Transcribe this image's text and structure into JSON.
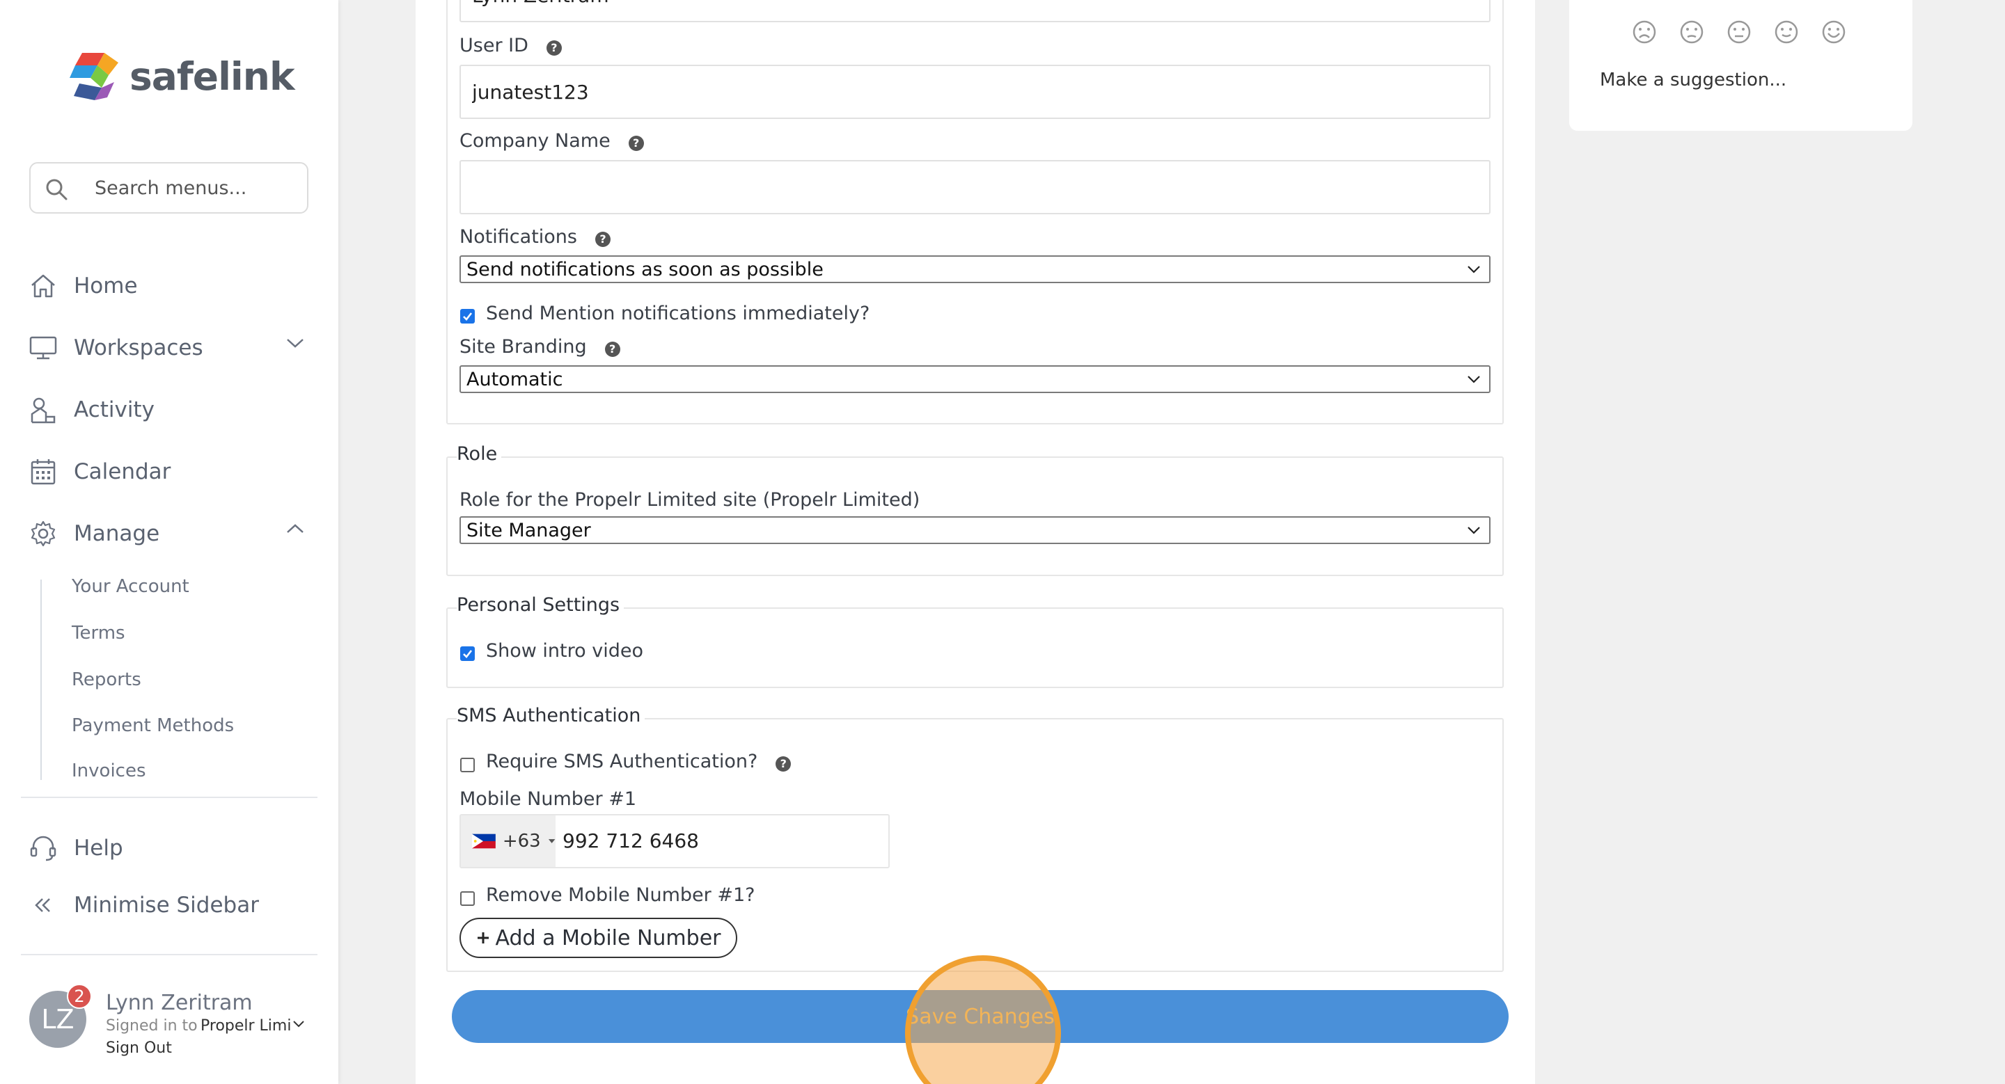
{
  "brand": {
    "name": "safelink"
  },
  "search": {
    "placeholder": "Search menus..."
  },
  "nav": {
    "home": "Home",
    "workspaces": "Workspaces",
    "activity": "Activity",
    "calendar": "Calendar",
    "manage": "Manage",
    "manage_items": [
      "Your Account",
      "Terms",
      "Reports",
      "Payment Methods",
      "Invoices"
    ],
    "help": "Help",
    "minimise": "Minimise Sidebar"
  },
  "user": {
    "initials": "LZ",
    "notifications": "2",
    "name": "Lynn Zeritram",
    "signed_in_label": "Signed in to",
    "organisation": "Propelr Limited",
    "sign_out": "Sign Out"
  },
  "form": {
    "name_value": "Lynn Zeritram",
    "user_id_label": "User ID",
    "user_id_value": "junatest123",
    "company_label": "Company Name",
    "company_value": "",
    "notifications_label": "Notifications",
    "notifications_value": "Send notifications as soon as possible",
    "mention_label": "Send Mention notifications immediately?",
    "site_branding_label": "Site Branding",
    "site_branding_value": "Automatic",
    "role_legend": "Role",
    "role_label": "Role for the Propelr Limited site (Propelr Limited)",
    "role_value": "Site Manager",
    "personal_legend": "Personal Settings",
    "intro_label": "Show intro video",
    "sms_legend": "SMS Authentication",
    "sms_label": "Require SMS Authentication?",
    "mobile_label": "Mobile Number #1",
    "country_code": "+63",
    "mobile_value": "992 712 6468",
    "remove_label": "Remove Mobile Number #1?",
    "add_mobile": "Add a Mobile Number",
    "save": "Save Changes"
  },
  "feedback": {
    "suggest": "Make a suggestion..."
  },
  "colors": {
    "accent": "#4a90d9",
    "highlight": "#f0a030",
    "badge": "#d9534f",
    "checkbox": "#1a73e8"
  }
}
